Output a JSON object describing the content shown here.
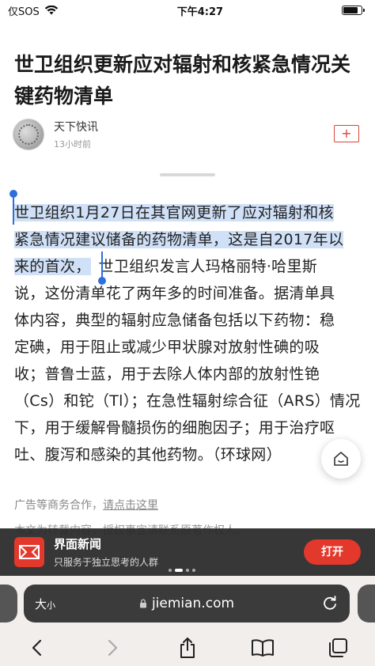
{
  "status_bar": {
    "carrier": "仅SOS",
    "time": "下午4:27",
    "battery_level": 0.85
  },
  "article": {
    "title": "世卫组织更新应对辐射和核紧急情况关键药物清单",
    "author": "天下快讯",
    "published": "13小时前",
    "follow_label": "+",
    "body_lines": [
      "世卫组织1月27日在其官网更新了应对辐射和核",
      "紧急情况建议储备的药物清单，这是自2017年以",
      "来的首次，",
      "世卫组织发言人玛格丽特·哈里斯",
      "说，这份清单花了两年多的时间准备。据清单具",
      "体内容，典型的辐射应急储备包括以下药物：稳",
      "定碘，用于阻止或减少甲状腺对放射性碘的吸",
      "收；普鲁士蓝，用于去除人体内部的放射性铯",
      "（Cs）和铊（Tl）；在急性辐射综合征（ARS）情况",
      "下，用于缓解骨髓损伤的细胞因子；用于治疗呕",
      "吐、腹泻和感染的其他药物。（环球网）"
    ],
    "ad_prefix": "广告等商务合作，",
    "ad_link": "请点击这里",
    "repost_notice": "本文为转载内容，授权事宜请联系原著作权人。"
  },
  "app_banner": {
    "name": "界面新闻",
    "slogan": "只服务于独立思考的人群",
    "open_label": "打开"
  },
  "browser": {
    "text_size_big": "大",
    "text_size_small": "小",
    "url": "jiemian.com"
  },
  "icons": {
    "wifi": "wifi-icon",
    "battery": "battery-icon",
    "home": "home-icon",
    "lock": "lock-icon",
    "reload": "reload-icon",
    "back": "back-icon",
    "forward": "forward-icon",
    "share": "share-icon",
    "bookmarks": "book-icon",
    "tabs": "tabs-icon"
  },
  "colors": {
    "accent": "#e3382c",
    "selection": "#cfe0f7",
    "selection_handle": "#2f6fdc"
  }
}
